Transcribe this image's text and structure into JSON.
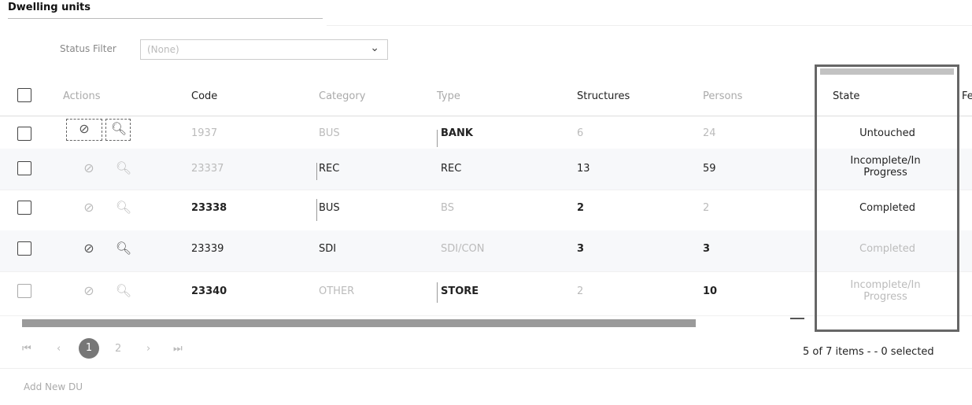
{
  "page": {
    "title": "Dwelling units"
  },
  "filter": {
    "label": "Status Filter",
    "value": "(None)"
  },
  "table": {
    "headers": {
      "actions": "Actions",
      "code": "Code",
      "category": "Category",
      "type": "Type",
      "structures": "Structures",
      "persons": "Persons",
      "state": "State",
      "overflow": "Fe"
    },
    "rows": [
      {
        "code": "1937",
        "category": "BUS",
        "type": "BANK",
        "structures": "6",
        "persons": "24",
        "state": "Untouched"
      },
      {
        "code": "23337",
        "category": "REC",
        "type": "REC",
        "structures": "13",
        "persons": "59",
        "state": "Incomplete/In Progress"
      },
      {
        "code": "23338",
        "category": "BUS",
        "type": "BS",
        "structures": "2",
        "persons": "2",
        "state": "Completed"
      },
      {
        "code": "23339",
        "category": "SDI",
        "type": "SDI/CON",
        "structures": "3",
        "persons": "3",
        "state": "Completed"
      },
      {
        "code": "23340",
        "category": "OTHER",
        "type": "STORE",
        "structures": "2",
        "persons": "10",
        "state": "Incomplete/In Progress"
      }
    ]
  },
  "pagination": {
    "first": "⏮",
    "prev": "‹",
    "current_page": "1",
    "next_page": "2",
    "next": "›",
    "last": "⏭",
    "summary": "5 of 7 items - - 0 selected"
  },
  "footer": {
    "add_label": "Add New DU"
  },
  "icons": {
    "edit": "edit-circle-icon",
    "search": "magnifier-icon"
  }
}
